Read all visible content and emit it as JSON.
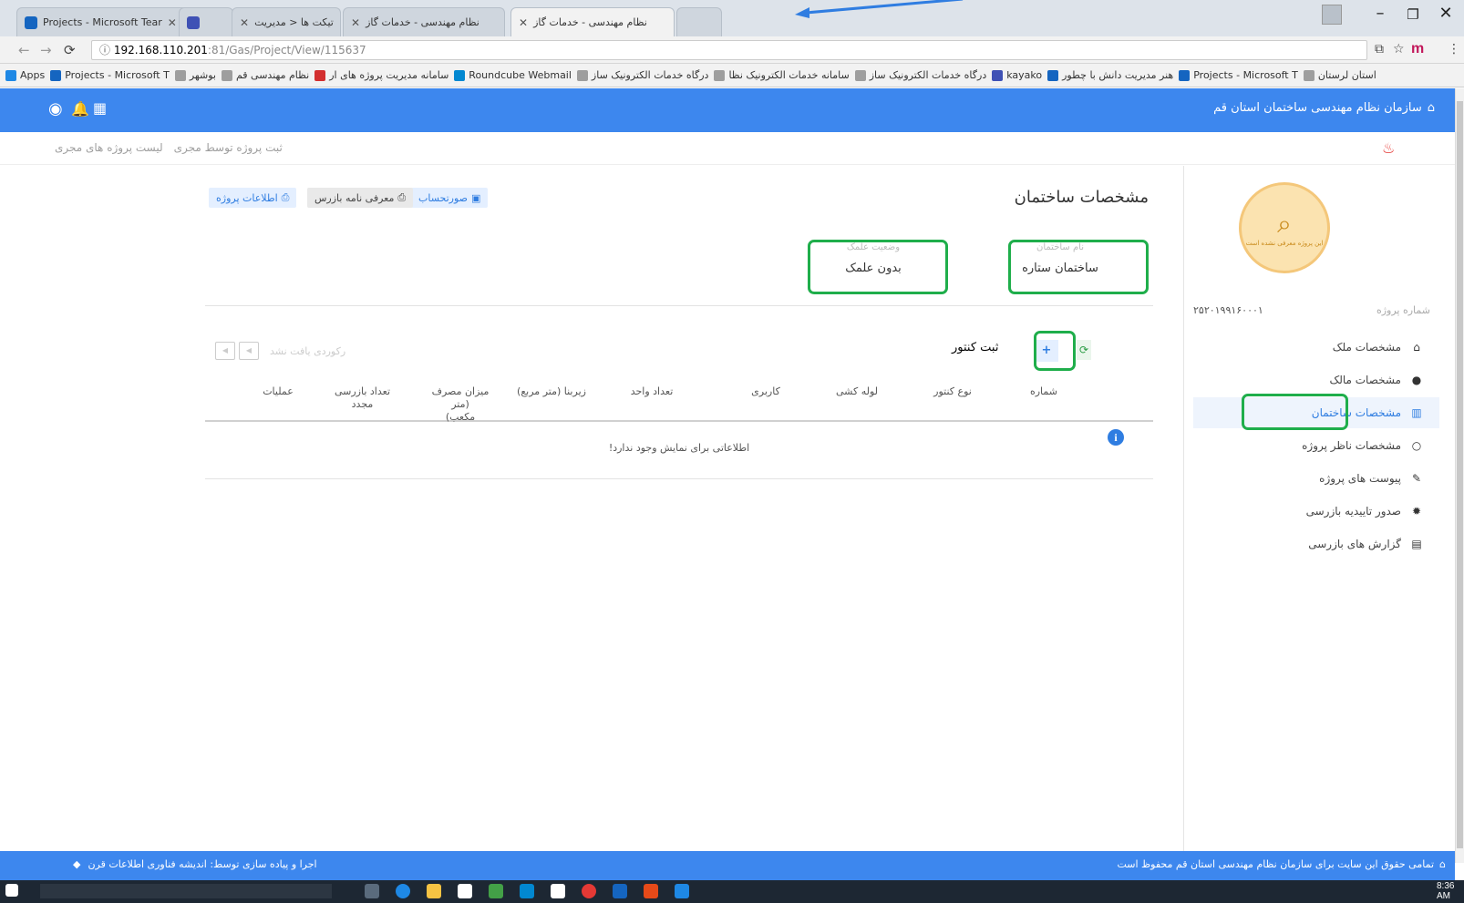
{
  "browser": {
    "tabs": [
      {
        "label": "Projects - Microsoft Tear",
        "active": false
      },
      {
        "label": "",
        "active": false
      },
      {
        "label": "تیکت ها < مدیریت",
        "active": false
      },
      {
        "label": "نظام مهندسی - خدمات گاز",
        "active": false
      },
      {
        "label": "نظام مهندسی - خدمات گاز",
        "active": true
      },
      {
        "label": "",
        "active": false
      }
    ],
    "url_host": "192.168.110.201",
    "url_path": ":81/Gas/Project/View/115637",
    "extension_label": "m",
    "bookmarks": [
      {
        "label": "Apps",
        "color": "#1e88e5"
      },
      {
        "label": "Projects - Microsoft T",
        "color": "#1565c0"
      },
      {
        "label": "بوشهر",
        "color": "#9e9e9e"
      },
      {
        "label": "نظام مهندسی قم",
        "color": "#9e9e9e"
      },
      {
        "label": "سامانه مدیریت پروژه های ار",
        "color": "#d32f2f"
      },
      {
        "label": "Roundcube Webmail",
        "color": "#0288d1"
      },
      {
        "label": "درگاه خدمات الکترونیک ساز",
        "color": "#9e9e9e"
      },
      {
        "label": "سامانه خدمات الکترونیک نظا",
        "color": "#9e9e9e"
      },
      {
        "label": "درگاه خدمات الکترونیک ساز",
        "color": "#9e9e9e"
      },
      {
        "label": "kayako",
        "color": "#3f51b5"
      },
      {
        "label": "هنر مدیریت دانش با چطور",
        "color": "#1565c0"
      },
      {
        "label": "Projects - Microsoft T",
        "color": "#1565c0"
      },
      {
        "label": "استان لرستان",
        "color": "#9e9e9e"
      }
    ]
  },
  "header": {
    "site_title": "سازمان نظام مهندسی ساختمان استان قم"
  },
  "breadcrumb": {
    "item1": "ثبت پروژه توسط مجری",
    "item2": "لیست پروژه های مجری"
  },
  "sidebar": {
    "logo_caption": "این پروژه معرفی نشده است",
    "project_number_label": "شماره پروژه",
    "project_number_value": "۲۵۲۰۱۹۹۱۶۰۰۰۱",
    "items": [
      {
        "label": "مشخصات ملک",
        "icon": "home-icon",
        "active": false
      },
      {
        "label": "مشخصات مالک",
        "icon": "user-icon",
        "active": false
      },
      {
        "label": "مشخصات ساختمان",
        "icon": "building-icon",
        "active": true
      },
      {
        "label": "مشخصات ناظر پروژه",
        "icon": "user-outline-icon",
        "active": false
      },
      {
        "label": "پیوست های پروژه",
        "icon": "paperclip-icon",
        "active": false
      },
      {
        "label": "صدور تاییدیه بازرسی",
        "icon": "gear-icon",
        "active": false
      },
      {
        "label": "گزارش های بازرسی",
        "icon": "file-icon",
        "active": false
      }
    ]
  },
  "main": {
    "title": "مشخصات ساختمان",
    "buttons": {
      "statement": "صورتحساب",
      "inspector_letter": "معرفی نامه بازرس",
      "project_info": "اطلاعات پروژه"
    },
    "fields": {
      "building_name_label": "نام ساختمان",
      "building_name_value": "ساختمان ستاره",
      "sign_status_label": "وضعیت علمک",
      "sign_status_value": "بدون علمک"
    },
    "add_meter_caption": "ثبت کنتور",
    "add_button_label": "+",
    "pager_text": "رکوردی یافت نشد",
    "table_headers": {
      "number": "شماره",
      "meter_type": "نوع کنتور",
      "pipe": "لوله کشی",
      "usage": "کاربری",
      "units": "تعداد واحد",
      "area": "زیربنا (متر مربع)",
      "consumption_line1": "میزان مصرف (متر",
      "consumption_line2": "مکعب)",
      "reinspect_line1": "تعداد بازرسی",
      "reinspect_line2": "مجدد",
      "operations": "عملیات"
    },
    "empty_message": "اطلاعاتی برای نمایش وجود ندارد!"
  },
  "footer": {
    "copyright": "تمامی حقوق این سایت برای سازمان نظام مهندسی استان قم محفوظ است",
    "developer": "اجرا و پیاده سازی توسط: اندیشه فناوری اطلاعات قرن"
  },
  "taskbar": {
    "clock": "8:36 AM"
  },
  "colors": {
    "brand_blue": "#3d87ee",
    "highlight_green": "#1fae4b",
    "accent_blue": "#2f7de1"
  }
}
